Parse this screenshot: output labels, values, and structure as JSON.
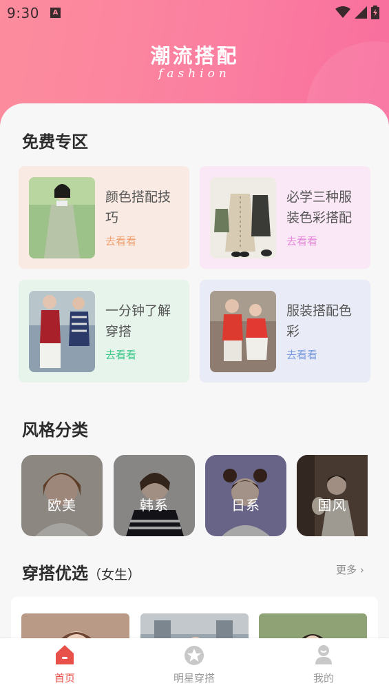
{
  "status_bar": {
    "time": "9:30"
  },
  "header": {
    "title": "潮流搭配",
    "subtitle": "fashion"
  },
  "free_zone": {
    "title": "免费专区",
    "cards": [
      {
        "text": "颜色搭配技巧",
        "action": "去看看",
        "action_color": "#f0a070",
        "bg": "#f9ebe3"
      },
      {
        "text": "必学三种服装色彩搭配",
        "action": "去看看",
        "action_color": "#e48ad8",
        "bg": "#fbe8f6"
      },
      {
        "text": "一分钟了解穿搭",
        "action": "去看看",
        "action_color": "#3ec88a",
        "bg": "#e6f4ec"
      },
      {
        "text": "服装搭配色彩",
        "action": "去看看",
        "action_color": "#7a9be0",
        "bg": "#e9ecf6"
      }
    ]
  },
  "style_category": {
    "title": "风格分类",
    "items": [
      {
        "label": "欧美"
      },
      {
        "label": "韩系"
      },
      {
        "label": "日系"
      },
      {
        "label": "国风"
      }
    ]
  },
  "picks": {
    "title": "穿搭优选",
    "subtitle": "（女生）",
    "more": "更多"
  },
  "tabbar": {
    "tabs": [
      {
        "label": "首页",
        "icon": "home-icon",
        "active": true
      },
      {
        "label": "明星穿搭",
        "icon": "star-icon",
        "active": false
      },
      {
        "label": "我的",
        "icon": "user-icon",
        "active": false
      }
    ],
    "active_color": "#e8504a",
    "inactive_color": "#999999"
  }
}
